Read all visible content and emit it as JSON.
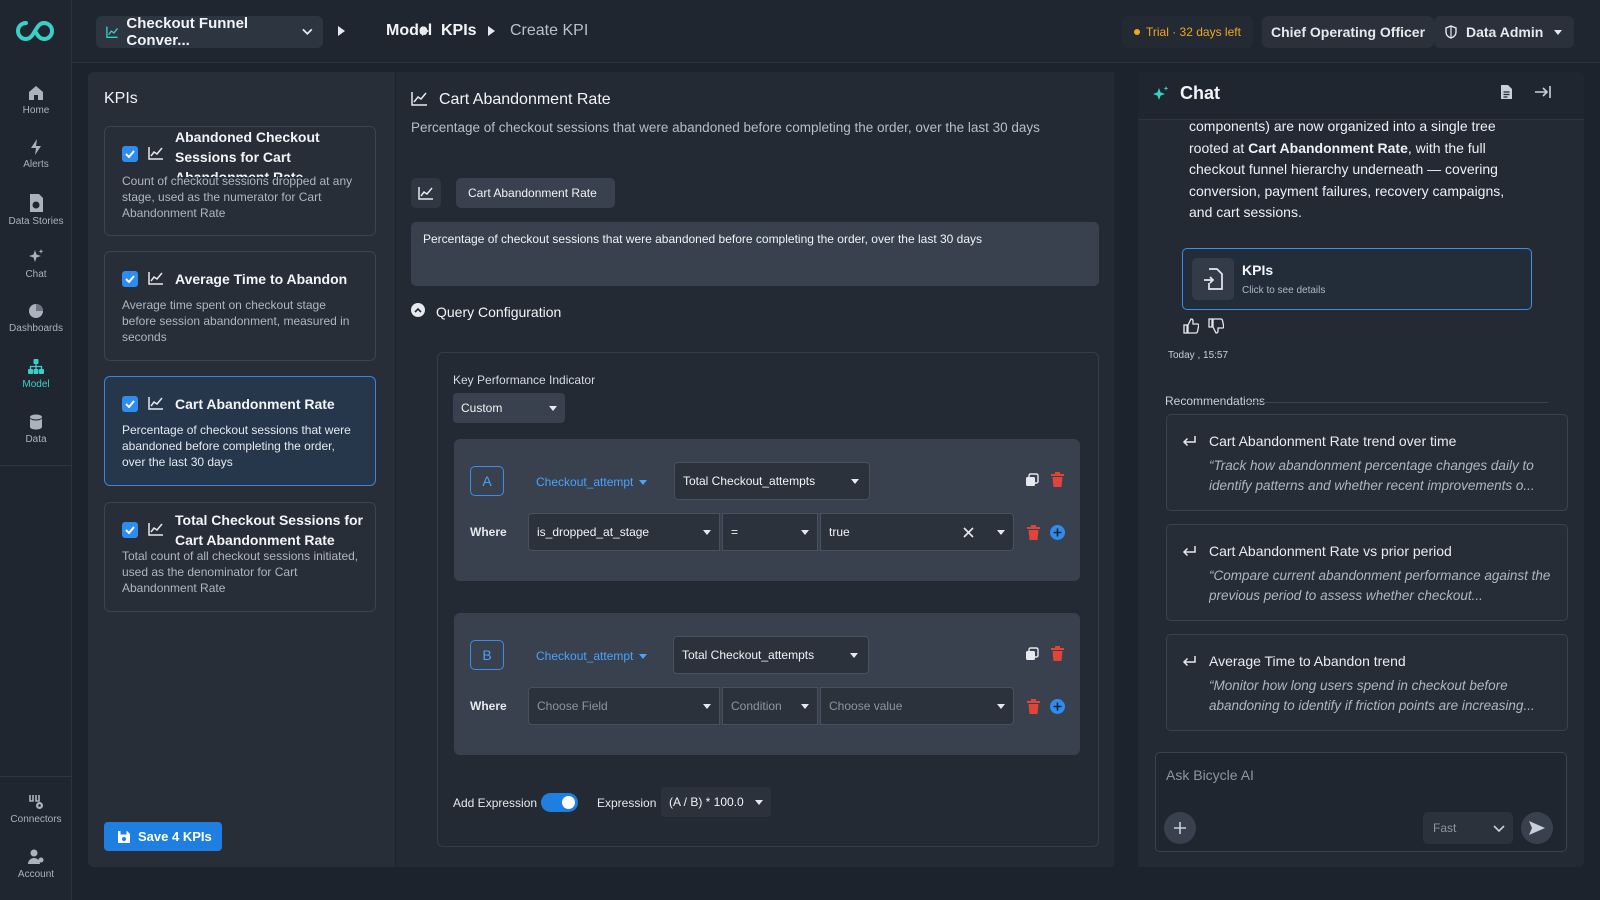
{
  "nav": {
    "items": [
      {
        "label": "Home",
        "icon": "home-icon"
      },
      {
        "label": "Alerts",
        "icon": "alerts-icon"
      },
      {
        "label": "Data Stories",
        "icon": "data-stories-icon"
      },
      {
        "label": "Chat",
        "icon": "chat-sparkle-icon"
      },
      {
        "label": "Dashboards",
        "icon": "dashboards-icon"
      },
      {
        "label": "Model",
        "icon": "model-icon",
        "active": true
      },
      {
        "label": "Data",
        "icon": "database-icon"
      }
    ],
    "bottom": [
      {
        "label": "Connectors",
        "icon": "connectors-icon"
      },
      {
        "label": "Account",
        "icon": "account-icon"
      }
    ],
    "accent": "#3ad0c8"
  },
  "header": {
    "dashboard_select": "Checkout Funnel Conver...",
    "breadcrumbs": [
      "Model",
      "KPIs",
      "Create KPI"
    ],
    "trial": "Trial · 32 days left",
    "role": "Chief Operating Officer",
    "admin": "Data Admin"
  },
  "kpi_list": {
    "title": "KPIs",
    "items": [
      {
        "title": "Abandoned Checkout Sessions for Cart Abandonment Rate",
        "desc": "Count of checkout sessions dropped at any stage, used as the numerator for Cart Abandonment Rate",
        "checked": true
      },
      {
        "title": "Average Time to Abandon",
        "desc": "Average time spent on checkout stage before session abandonment, measured in seconds",
        "checked": true
      },
      {
        "title": "Cart Abandonment Rate",
        "desc": "Percentage of checkout sessions that were abandoned before completing the order, over the last 30 days",
        "checked": true,
        "selected": true
      },
      {
        "title": "Total Checkout Sessions for Cart Abandonment Rate",
        "desc": "Total count of all checkout sessions initiated, used as the denominator for Cart Abandonment Rate",
        "checked": true
      }
    ],
    "save_label": "Save 4 KPIs"
  },
  "editor": {
    "title": "Cart Abandonment Rate",
    "subtitle": "Percentage of checkout sessions that were abandoned before completing the order, over the last 30 days",
    "name_value": "Cart Abandonment Rate",
    "desc_value": "Percentage of checkout sessions that were abandoned before completing the order, over the last 30 days",
    "query_label": "Query Configuration",
    "kpi_type_label": "Key Performance Indicator",
    "kpi_type_value": "Custom",
    "blocks": [
      {
        "letter": "A",
        "source": "Checkout_attempt",
        "aggregation": "Total Checkout_attempts",
        "where_label": "Where",
        "field": "is_dropped_at_stage",
        "operator": "=",
        "value": "true"
      },
      {
        "letter": "B",
        "source": "Checkout_attempt",
        "aggregation": "Total Checkout_attempts",
        "where_label": "Where",
        "field_placeholder": "Choose Field",
        "operator_placeholder": "Condition",
        "value_placeholder": "Choose value"
      }
    ],
    "add_expression_label": "Add Expression",
    "add_expression_on": true,
    "expression_label": "Expression",
    "expression_value": "(A / B) * 100.0"
  },
  "chat": {
    "title": "Chat",
    "message_text_1": "components) are now organized into a single tree rooted at ",
    "message_bold": "Cart Abandonment Rate",
    "message_text_2": ", with the full checkout funnel hierarchy underneath — covering conversion, payment failures, recovery campaigns, and cart sessions.",
    "card_title": "KPIs",
    "card_sub": "Click to see details",
    "timestamp": "Today , 15:57",
    "recommendations_label": "Recommendations",
    "recommendations": [
      {
        "title": "Cart Abandonment Rate trend over time",
        "quote": "“Track how abandonment percentage changes daily to identify patterns and whether recent improvements o..."
      },
      {
        "title": "Cart Abandonment Rate vs prior period",
        "quote": "“Compare current abandonment performance against the previous period to assess whether checkout..."
      },
      {
        "title": "Average Time to Abandon trend",
        "quote": "“Monitor how long users spend in checkout before abandoning to identify if friction points are increasing..."
      }
    ],
    "input_placeholder": "Ask Bicycle AI",
    "mode": "Fast"
  }
}
